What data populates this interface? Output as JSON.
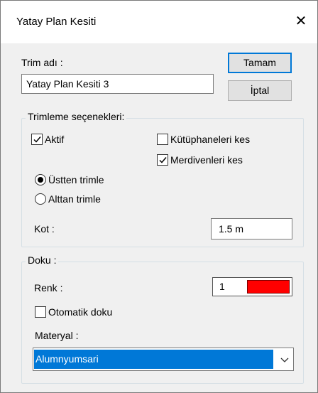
{
  "window": {
    "title": "Yatay Plan Kesiti",
    "close_glyph": "✕"
  },
  "trim": {
    "label": "Trim adı :",
    "value": "Yatay Plan Kesiti  3"
  },
  "buttons": {
    "ok": "Tamam",
    "cancel": "İptal"
  },
  "options_group": {
    "title": "Trimleme seçenekleri:",
    "active": {
      "label": "Aktif",
      "checked": true
    },
    "cut_libraries": {
      "label": "Kütüphaneleri kes",
      "checked": false
    },
    "cut_stairs": {
      "label": "Merdivenleri kes",
      "checked": true
    },
    "trim_from_top": {
      "label": "Üstten trimle",
      "selected": true
    },
    "trim_from_bottom": {
      "label": "Alttan trimle",
      "selected": false
    },
    "elevation": {
      "label": "Kot :",
      "value": "1.5 m"
    }
  },
  "texture_group": {
    "title": "Doku :",
    "color": {
      "label": "Renk :",
      "number": "1",
      "swatch": "#ff0000"
    },
    "auto_texture": {
      "label": "Otomatik doku",
      "checked": false
    },
    "material": {
      "label": "Materyal :",
      "value": "Alumnyumsari"
    }
  },
  "colors": {
    "accent": "#0078d7",
    "dialog_bg": "#f0f0f0"
  }
}
